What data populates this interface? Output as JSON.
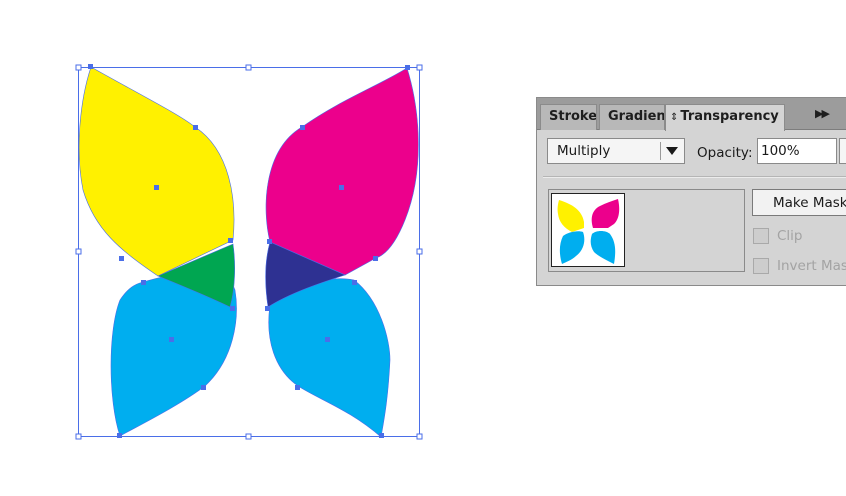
{
  "colors": {
    "yellow": "#fff100",
    "magenta": "#ec008c",
    "cyan": "#00aeef",
    "green": "#00a651",
    "navy": "#2e3192",
    "selection": "#4a6ee8"
  },
  "canvas": {
    "artwork": "butterfly-shapes",
    "icons": [
      "selection-bounding-box",
      "anchor-point"
    ]
  },
  "panel": {
    "tabs": [
      {
        "label": "Stroke",
        "active": false
      },
      {
        "label": "Gradien",
        "active": false
      },
      {
        "label": "Transparency",
        "active": true
      }
    ],
    "tab_icon": "updown-arrows-icon",
    "menu_icon": "double-chevron-right-icon",
    "blend_mode": "Multiply",
    "opacity_label": "Opacity:",
    "opacity_value": "100%",
    "make_mask_label": "Make Mask",
    "clip_label": "Clip",
    "invert_mask_label": "Invert Mas",
    "clip_checked": false,
    "invert_checked": false
  }
}
